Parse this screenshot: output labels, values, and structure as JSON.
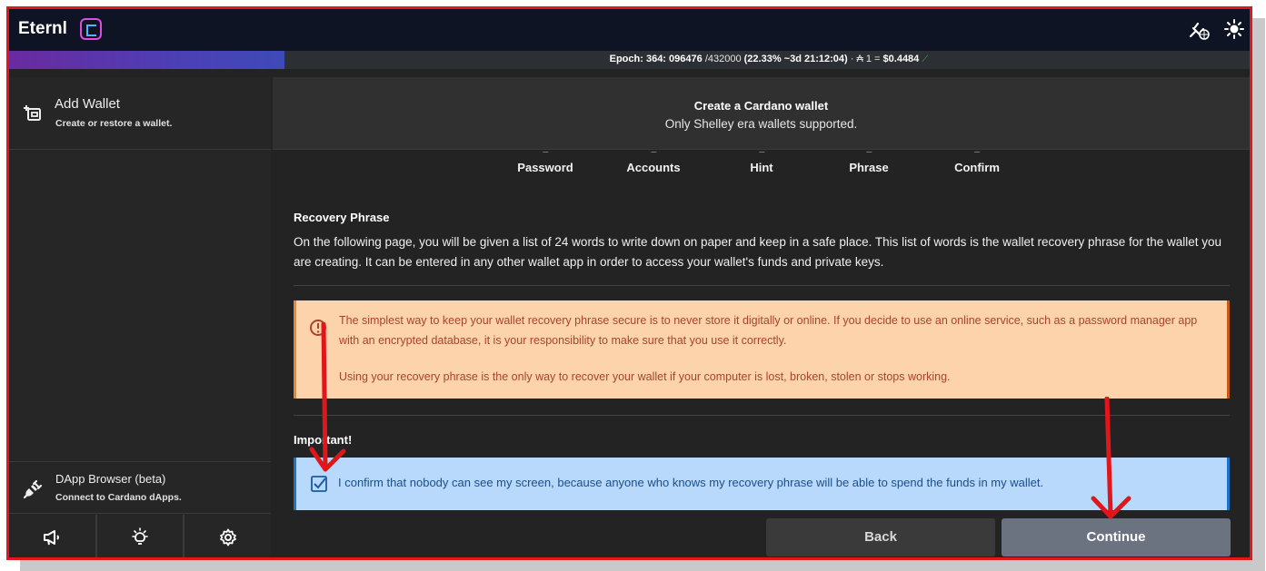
{
  "app": {
    "title": "Eternl"
  },
  "epoch_bar": {
    "epoch_prefix": "Epoch: 364: 096476",
    "epoch_total": "/432000",
    "epoch_progress": "(22.33% ~3d 21:12:04)",
    "price_prefix": "· ₳ 1 =",
    "price_value": "$0.4484",
    "progress_fraction": 0.2233,
    "trend_icon": "trend-up-icon"
  },
  "sidebar": {
    "add_wallet_title": "Add Wallet",
    "add_wallet_subtitle": "Create or restore a wallet.",
    "dapp_title": "DApp Browser (beta)",
    "dapp_subtitle": "Connect to Cardano dApps.",
    "tools": [
      "megaphone-icon",
      "lightbulb-icon",
      "settings-icon"
    ]
  },
  "header": {
    "title": "Create a Cardano wallet",
    "subtitle": "Only Shelley era wallets supported."
  },
  "steps": [
    "Password",
    "Accounts",
    "Hint",
    "Phrase",
    "Confirm"
  ],
  "recovery": {
    "title": "Recovery Phrase",
    "text": "On the following page, you will be given a list of 24 words to write down on paper and keep in a safe place. This list of words is the wallet recovery phrase for the wallet you are creating. It can be entered in any other wallet app in order to access your wallet's funds and private keys."
  },
  "warning": {
    "p1": "The simplest way to keep your wallet recovery phrase secure is to never store it digitally or online. If you decide to use an online service, such as a password manager app with an encrypted database, it is your responsibility to make sure that you use it correctly.",
    "p2": "Using your recovery phrase is the only way to recover your wallet if your computer is lost, broken, stolen or stops working."
  },
  "important": {
    "title": "Important!",
    "confirm_text": "I confirm that nobody can see my screen, because anyone who knows my recovery phrase will be able to spend the funds in my wallet.",
    "checked": true
  },
  "buttons": {
    "back": "Back",
    "continue": "Continue"
  },
  "colors": {
    "annotation_red": "#e0161b",
    "warning_bg": "#fcd3ab",
    "confirm_bg": "#b8d9fb"
  }
}
